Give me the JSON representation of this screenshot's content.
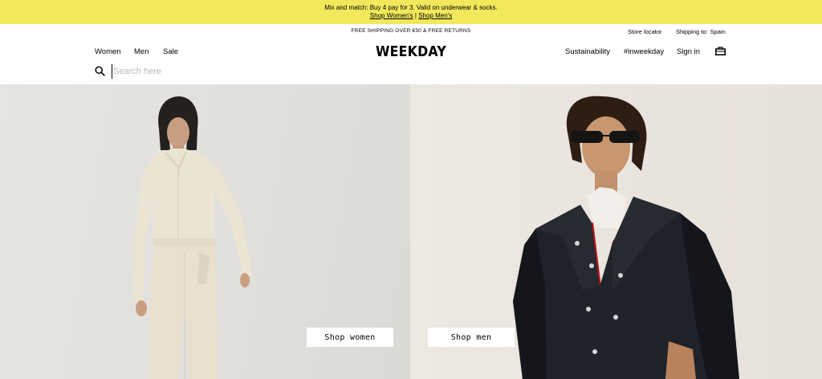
{
  "promo": {
    "message": "Mix and match: Buy 4 pay for 3. Valid on underwear & socks.",
    "link_women": "Shop Women's",
    "separator": "|",
    "link_men": "Shop Men's",
    "background_color": "#f2e85c"
  },
  "topbar": {
    "free_shipping": "FREE SHIPPING OVER €50 & FREE RETURNS",
    "store_locator": "Store locator",
    "shipping_label": "Shipping to:",
    "shipping_country": "Spain"
  },
  "nav": {
    "left_items": [
      "Women",
      "Men",
      "Sale"
    ],
    "logo": "WEEKDAY",
    "right_items": [
      "Sustainability",
      "#inweekday",
      "Sign in"
    ],
    "bag_icon": "shopping-bag-icon"
  },
  "search": {
    "icon": "search-icon",
    "placeholder": "Search here",
    "value": ""
  },
  "hero": {
    "women_button": "Shop women",
    "men_button": "Shop men"
  }
}
